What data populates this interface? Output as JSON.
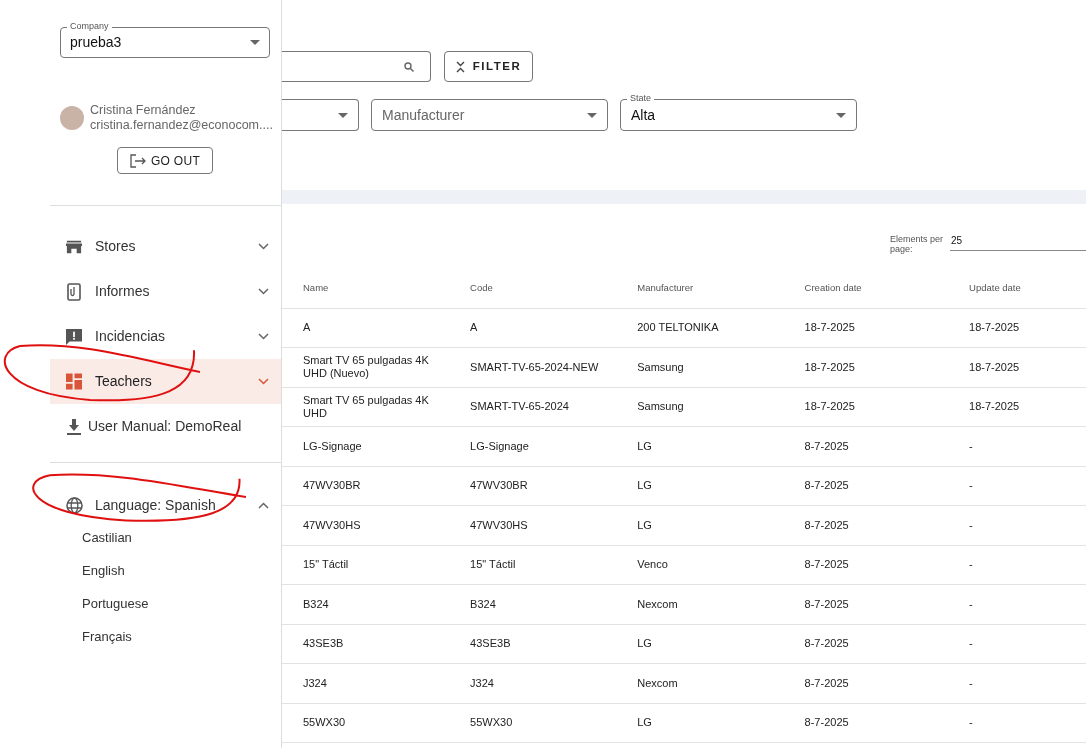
{
  "sidebar": {
    "company": {
      "label": "Company",
      "value": "prueba3"
    },
    "user": {
      "name": "Cristina Fernández",
      "email": "cristina.fernandez@econocom...."
    },
    "logout_button": "GO OUT",
    "menu": [
      {
        "label": "Stores",
        "kind": "group",
        "selected": false,
        "expanded": false,
        "circled": false
      },
      {
        "label": "Informes",
        "kind": "group",
        "selected": false,
        "expanded": false,
        "circled": false
      },
      {
        "label": "Incidencias",
        "kind": "group",
        "selected": false,
        "expanded": false,
        "circled": false
      },
      {
        "label": "Teachers",
        "kind": "group",
        "selected": true,
        "expanded": false,
        "circled": true
      },
      {
        "label": "User Manual: DemoReal",
        "kind": "link",
        "selected": false,
        "circled": false
      }
    ],
    "language": {
      "label": "Language: Spanish",
      "expanded": true,
      "circled": true,
      "options": [
        "Castilian",
        "English",
        "Portuguese",
        "Français"
      ]
    }
  },
  "toolbar": {
    "filter_button": "FILTER"
  },
  "filters": [
    {
      "kind": "select"
    },
    {
      "kind": "select",
      "placeholder": "Manufacturer"
    },
    {
      "kind": "select",
      "label": "State",
      "value": "Alta"
    }
  ],
  "pagination": {
    "label": "Elements per page:",
    "value": "25"
  },
  "table": {
    "columns": [
      "Name",
      "Code",
      "Manufacturer",
      "Creation date",
      "Update date"
    ],
    "rows": [
      [
        "A",
        "A",
        "200 TELTONIKA",
        "18-7-2025",
        "18-7-2025"
      ],
      [
        "Smart TV 65 pulgadas 4K UHD (Nuevo)",
        "SMART-TV-65-2024-NEW",
        "Samsung",
        "18-7-2025",
        "18-7-2025"
      ],
      [
        "Smart TV 65 pulgadas 4K UHD",
        "SMART-TV-65-2024",
        "Samsung",
        "18-7-2025",
        "18-7-2025"
      ],
      [
        "LG-Signage",
        "LG-Signage",
        "LG",
        "8-7-2025",
        "-"
      ],
      [
        "47WV30BR",
        "47WV30BR",
        "LG",
        "8-7-2025",
        "-"
      ],
      [
        "47WV30HS",
        "47WV30HS",
        "LG",
        "8-7-2025",
        "-"
      ],
      [
        "15\" Táctil",
        "15\" Táctil",
        "Venco",
        "8-7-2025",
        "-"
      ],
      [
        "B324",
        "B324",
        "Nexcom",
        "8-7-2025",
        "-"
      ],
      [
        "43SE3B",
        "43SE3B",
        "LG",
        "8-7-2025",
        "-"
      ],
      [
        "J324",
        "J324",
        "Nexcom",
        "8-7-2025",
        "-"
      ],
      [
        "55WX30",
        "55WX30",
        "LG",
        "8-7-2025",
        "-"
      ]
    ]
  }
}
